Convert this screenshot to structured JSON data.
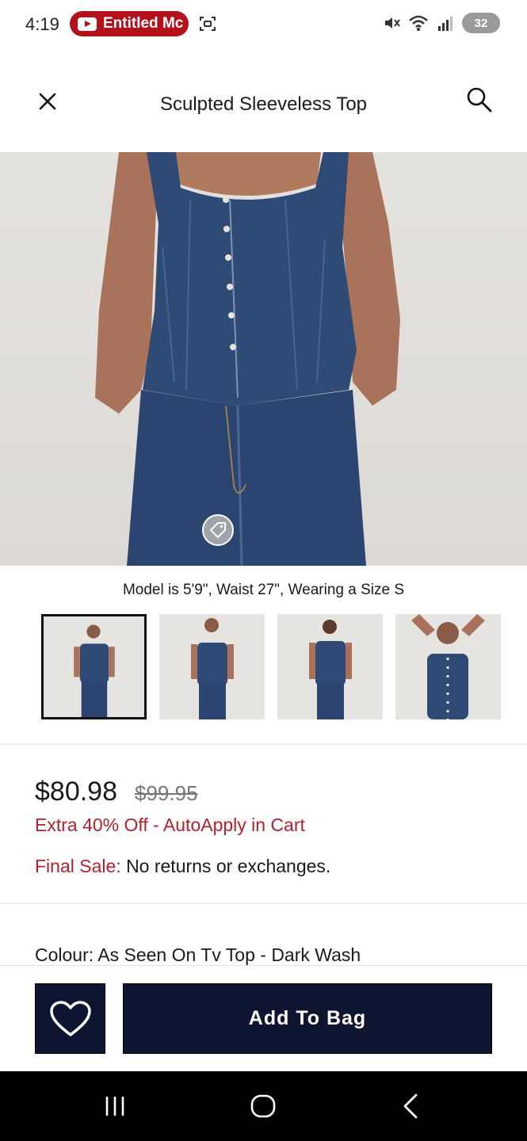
{
  "status_bar": {
    "time": "4:19",
    "notification_app": "Entitled Mc",
    "battery": "32",
    "icons": [
      "youtube-icon",
      "screenshot-icon",
      "mute-icon",
      "wifi-icon",
      "signal-icon",
      "battery-icon"
    ]
  },
  "header": {
    "title": "Sculpted Sleeveless Top",
    "close_icon": "close-icon",
    "search_icon": "search-icon"
  },
  "product": {
    "model_info": "Model is 5'9\", Waist 27\", Wearing a Size S",
    "thumbnails_count": 4,
    "selected_thumbnail": 1,
    "price_current": "$80.98",
    "price_original": "$99.95",
    "promo_text": "Extra 40% Off - AutoApply in Cart",
    "final_sale_label": "Final Sale:",
    "final_sale_text": "No returns or exchanges.",
    "colour_label": "Colour:",
    "colour_value": "As Seen On Tv Top - Dark Wash"
  },
  "actions": {
    "add_to_bag": "Add To Bag",
    "wishlist_icon": "heart-icon"
  },
  "colors": {
    "brand_navy": "#0e1530",
    "sale_red": "#b3212f",
    "denim": "#2f4a75"
  }
}
